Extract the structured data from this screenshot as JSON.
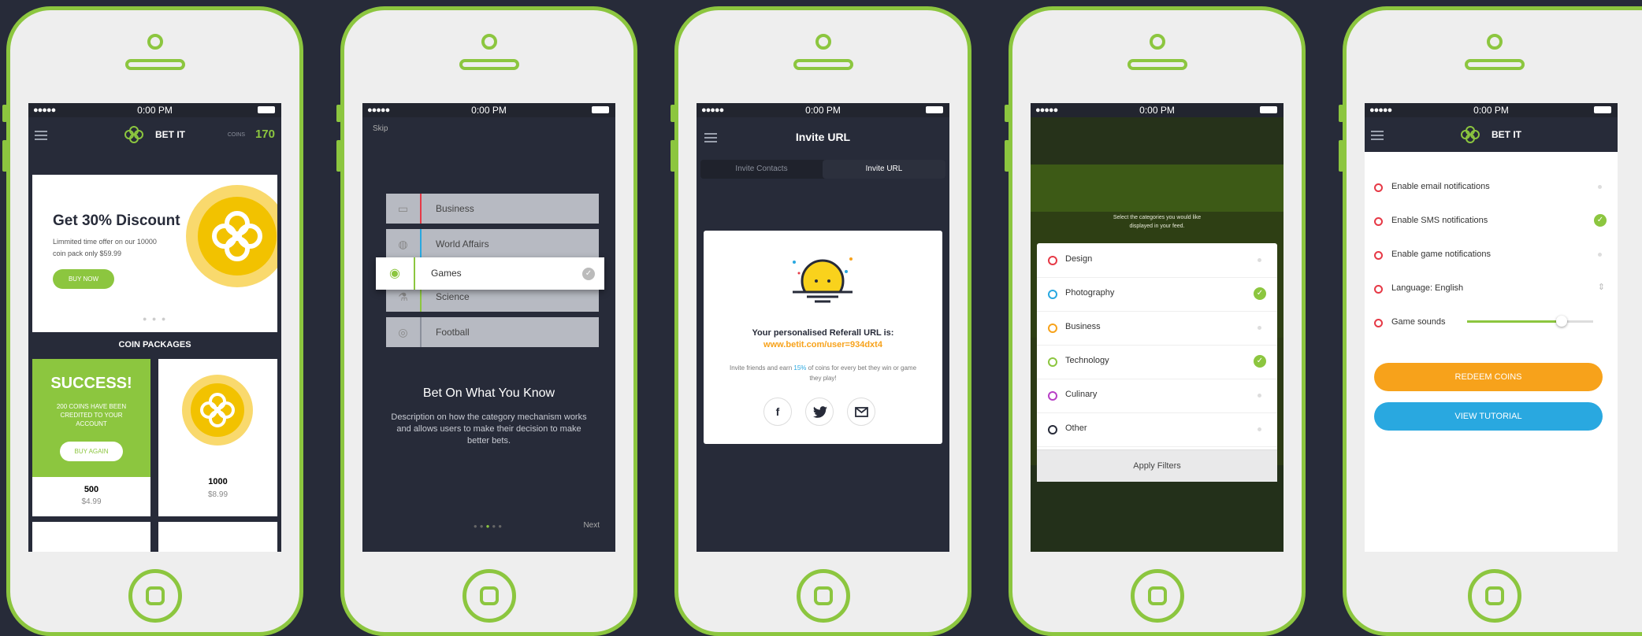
{
  "status": {
    "time": "0:00 PM",
    "signal": "●●●●●"
  },
  "colors": {
    "accent": "#8cc63f",
    "orange": "#f7a21b",
    "blue": "#29a8e0",
    "dark": "#272b39"
  },
  "s1": {
    "logo": "BET IT",
    "coins_label": "COINS",
    "coins_value": "170",
    "banner_title": "Get 30% Discount",
    "banner_desc": "Limmited time offer on our 10000 coin pack only $59.99",
    "buy_now": "BUY NOW",
    "section_title": "COIN PACKAGES",
    "success_title": "SUCCESS!",
    "success_desc": "200 COINS HAVE BEEN CREDITED TO YOUR ACCOUNT",
    "buy_again": "BUY AGAIN",
    "pack1_amount": "500",
    "pack1_price": "$4.99",
    "pack2_amount": "1000",
    "pack2_price": "$8.99"
  },
  "s2": {
    "skip": "Skip",
    "categories": [
      "Business",
      "World Affairs",
      "Games",
      "Science",
      "Football"
    ],
    "title": "Bet On What You Know",
    "desc": "Description on how the category mechanism works and allows users to make their decision to make better bets.",
    "next": "Next"
  },
  "s3": {
    "title": "Invite URL",
    "tab1": "Invite Contacts",
    "tab2": "Invite URL",
    "referral_label": "Your personalised Referall URL is:",
    "referral_url": "www.betit.com/user=934dxt4",
    "invite_pre": "Invite friends and earn ",
    "invite_pct": "15%",
    "invite_post": " of coins for every bet they win or game they play!"
  },
  "s4": {
    "prompt": "Select the categories you would like displayed in your feed.",
    "filters": [
      {
        "label": "Design",
        "color": "#e63946",
        "checked": false
      },
      {
        "label": "Photography",
        "color": "#29a8e0",
        "checked": true
      },
      {
        "label": "Business",
        "color": "#f7a21b",
        "checked": false
      },
      {
        "label": "Technology",
        "color": "#8cc63f",
        "checked": true
      },
      {
        "label": "Culinary",
        "color": "#b83fc6",
        "checked": false
      },
      {
        "label": "Other",
        "color": "#272b39",
        "checked": false
      }
    ],
    "apply": "Apply Filters"
  },
  "s5": {
    "logo": "BET IT",
    "settings": [
      {
        "label": "Enable email notifications",
        "control": "dot"
      },
      {
        "label": "Enable SMS notifications",
        "control": "check"
      },
      {
        "label": "Enable game notifications",
        "control": "dot"
      },
      {
        "label": "Language: English",
        "control": "select"
      },
      {
        "label": "Game sounds",
        "control": "slider"
      }
    ],
    "game_sounds_level": 0.75,
    "redeem": "REDEEM COINS",
    "tutorial": "VIEW TUTORIAL"
  }
}
